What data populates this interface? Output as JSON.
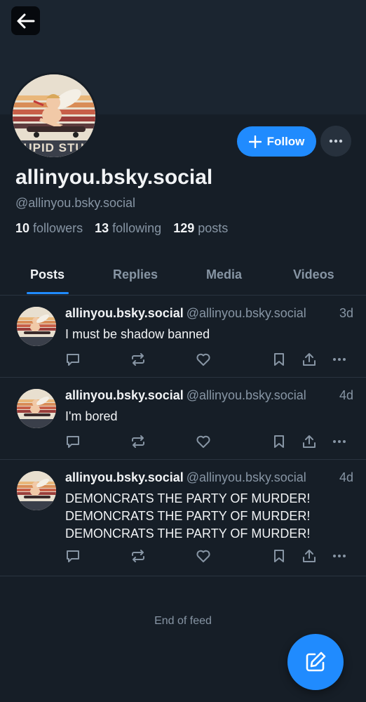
{
  "colors": {
    "background": "#161e27",
    "banner": "#1b2530",
    "accent": "#208bfe",
    "muted_text": "#8795a4",
    "divider": "#2a3440"
  },
  "header": {
    "back_icon": "arrow-left-icon"
  },
  "profile": {
    "avatar_text": "UPID STU",
    "follow_label": "Follow",
    "display_name": "allinyou.bsky.social",
    "handle": "@allinyou.bsky.social",
    "stats": {
      "followers_count": "10",
      "followers_label": "followers",
      "following_count": "13",
      "following_label": "following",
      "posts_count": "129",
      "posts_label": "posts"
    }
  },
  "tabs": [
    {
      "label": "Posts",
      "active": true
    },
    {
      "label": "Replies",
      "active": false
    },
    {
      "label": "Media",
      "active": false
    },
    {
      "label": "Videos",
      "active": false
    }
  ],
  "posts": [
    {
      "name": "allinyou.bsky.social",
      "handle": "@allinyou.bsky.social",
      "time": "3d",
      "lines": [
        "I must be shadow banned"
      ]
    },
    {
      "name": "allinyou.bsky.social",
      "handle": "@allinyou.bsky.social",
      "time": "4d",
      "lines": [
        "I'm bored"
      ]
    },
    {
      "name": "allinyou.bsky.social",
      "handle": "@allinyou.bsky.social",
      "time": "4d",
      "lines": [
        "DEMONCRATS THE PARTY OF MURDER!",
        "DEMONCRATS THE PARTY OF MURDER!",
        "DEMONCRATS THE PARTY OF MURDER!"
      ]
    }
  ],
  "feed": {
    "end_label": "End of feed"
  }
}
